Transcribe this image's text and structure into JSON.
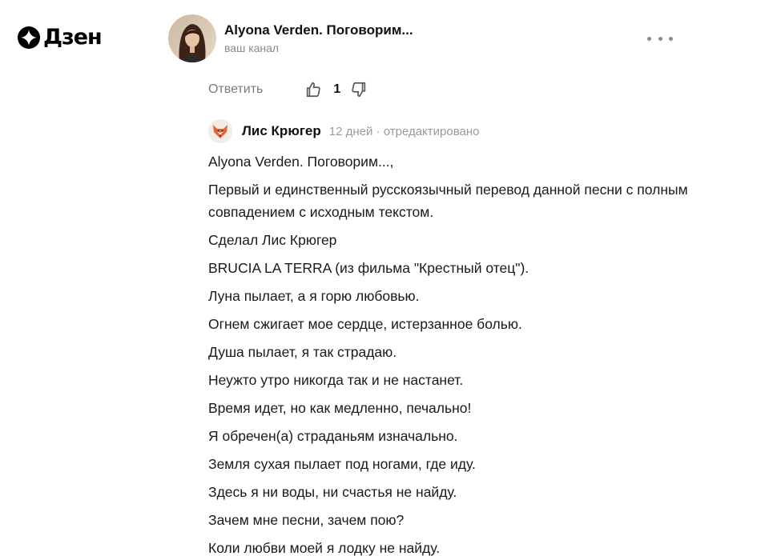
{
  "brand": {
    "logo_text": "Дзен"
  },
  "channel": {
    "name": "Alyona Verden. Поговорим...",
    "subtitle": "ваш канал"
  },
  "actions": {
    "reply_label": "Ответить",
    "like_count": "1"
  },
  "comment": {
    "author": "Лис Крюгер",
    "meta": "12 дней · отредактировано",
    "lines": [
      "Alyona Verden. Поговорим...,",
      "Первый и единственный русскоязычный перевод данной песни с полным совпадением с исходным текстом.",
      "Сделал Лис Крюгер",
      "BRUCIA LA TERRA (из фильма \"Крестный отец\").",
      "Луна пылает, а я горю любовью.",
      "Огнем сжигает мое сердце, истерзанное болью.",
      "Душа пылает, я так страдаю.",
      "Неужто утро никогда так и не настанет.",
      "Время идет, но как медленно, печально!",
      "Я обречен(а) страданьям изначально.",
      "Земля сухая пылает под ногами, где иду.",
      "Здесь я ни воды, ни счастья не найду.",
      "Зачем мне песни, зачем пою?",
      "Коли любви моей я лодку не найду."
    ]
  },
  "icons": {
    "logo": "dzen-star-icon",
    "more": "more-dots-icon",
    "like": "thumbs-up-icon",
    "dislike": "thumbs-down-icon",
    "fox": "fox-avatar-icon"
  },
  "colors": {
    "muted": "#7a7a7a",
    "meta": "#9a9a9a",
    "fox_orange": "#e8622c"
  }
}
